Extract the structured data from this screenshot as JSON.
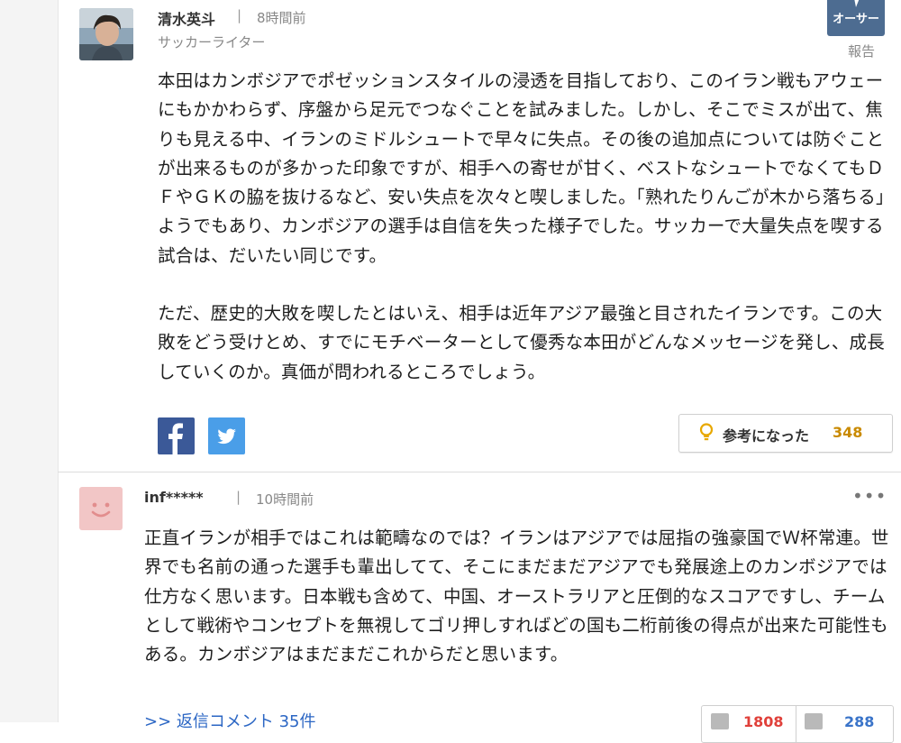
{
  "comment1": {
    "author_name": "清水英斗",
    "separator": "|",
    "time": "8時間前",
    "author_role": "サッカーライター",
    "author_badge": "オーサー",
    "report_label": "報告",
    "body_paragraphs": [
      "本田はカンボジアでポゼッションスタイルの浸透を目指しており、このイラン戦もアウェーにもかかわらず、序盤から足元でつなぐことを試みました。しかし、そこでミスが出て、焦りも見える中、イランのミドルシュートで早々に失点。その後の追加点については防ぐことが出来るものが多かった印象ですが、相手への寄せが甘く、ベストなシュートでなくてもＤＦやＧＫの脇を抜けるなど、安い失点を次々と喫しました。「熟れたりんごが木から落ちる」ようでもあり、カンボジアの選手は自信を失った様子でした。サッカーで大量失点を喫する試合は、だいたい同じです。",
      "ただ、歴史的大敗を喫したとはいえ、相手は近年アジア最強と目されたイランです。この大敗をどう受けとめ、すでにモチベーターとして優秀な本田がどんなメッセージを発し、成長していくのか。真価が問われるところでしょう。"
    ],
    "helpful_label": "参考になった",
    "helpful_count": "348"
  },
  "comment2": {
    "author_name": "inf*****",
    "separator": "|",
    "time": "10時間前",
    "more_menu": "•••",
    "body": "正直イランが相手ではこれは範疇なのでは？イランはアジアでは屈指の強豪国でＷ杯常連。世界でも名前の通った選手も輩出してて、そこにまだまだアジアでも発展途上のカンボジアでは仕方なく思います。日本戦も含めて、中国、オーストラリアと圧倒的なスコアですし、チームとして戦術やコンセプトを無視してゴリ押しすればどの国も二桁前後の得点が出来た可能性もある。カンボジアはまだまだこれからだと思います。",
    "replies_link": ">> 返信コメント 35件",
    "vote_up_count": "1808",
    "vote_down_count": "288"
  },
  "colors": {
    "facebook": "#3b5998",
    "twitter": "#4a9ee8",
    "author_badge": "#4d6c91",
    "helpful_count": "#c98a00",
    "vote_up": "#e0403a",
    "vote_down": "#3a74c9",
    "link": "#2b66c4"
  },
  "icons": {
    "share_facebook": "facebook-icon",
    "share_twitter": "twitter-icon",
    "helpful": "lightbulb-icon",
    "vote_up": "thumbs-up-icon",
    "vote_down": "thumbs-down-icon",
    "default_avatar": "smiley-face-icon"
  }
}
